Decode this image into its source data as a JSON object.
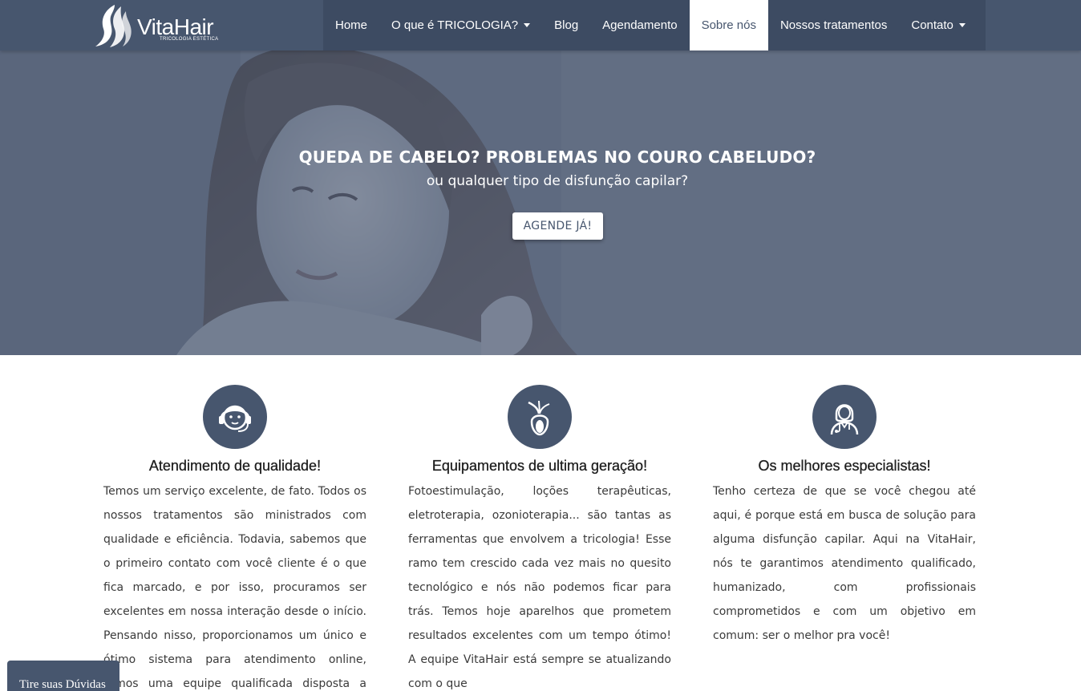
{
  "brand": {
    "name": "VitaHair",
    "tagline": "TRICOLOGIA ESTÉTICA"
  },
  "nav": {
    "items": [
      {
        "label": "Home"
      },
      {
        "label": "O que é TRICOLOGIA?"
      },
      {
        "label": "Blog"
      },
      {
        "label": "Agendamento"
      },
      {
        "label": "Sobre nós"
      },
      {
        "label": "Nossos tratamentos"
      },
      {
        "label": "Contato"
      }
    ]
  },
  "hero": {
    "title": "QUEDA DE CABELO? PROBLEMAS NO COURO CABELUDO?",
    "subtitle": "ou qualquer tipo de disfunção capilar?",
    "cta_label": "AGENDE JÁ!"
  },
  "features": [
    {
      "title": "Atendimento de qualidade!",
      "text": "Temos um serviço excelente, de fato. Todos os nossos tratamentos são ministrados com qualidade e eficiência. Todavia, sabemos que o primeiro contato com você cliente é o que fica marcado, e por isso, procuramos ser excelentes em nossa interação desde o início. Pensando nisso, proporcionamos um único e ótimo sistema para atendimento online, temos uma equipe qualificada disposta a responder seu"
    },
    {
      "title": "Equipamentos de ultima geração!",
      "text": "Fotoestimulação, loções terapêuticas, eletroterapia, ozonioterapia... são tantas as ferramentas que envolvem a tricologia! Esse ramo tem crescido cada vez mais no quesito tecnológico e nós não podemos ficar para trás. Temos hoje aparelhos que prometem resultados excelentes com um tempo ótimo! A equipe VitaHair está sempre se atualizando com o que"
    },
    {
      "title": "Os melhores especialistas!",
      "text": "Tenho certeza de que se você chegou até aqui, é porque está em busca de solução para alguma disfunção capilar. Aqui na VitaHair, nós te garantimos atendimento qualificado, humanizado, com profissionais comprometidos e com um objetivo em comum: ser o melhor pra você!"
    }
  ],
  "chat": {
    "label": "Tire suas Dúvidas"
  },
  "colors": {
    "primary": "#47566e",
    "nav_strip": "#3d4b62",
    "white": "#ffffff"
  }
}
